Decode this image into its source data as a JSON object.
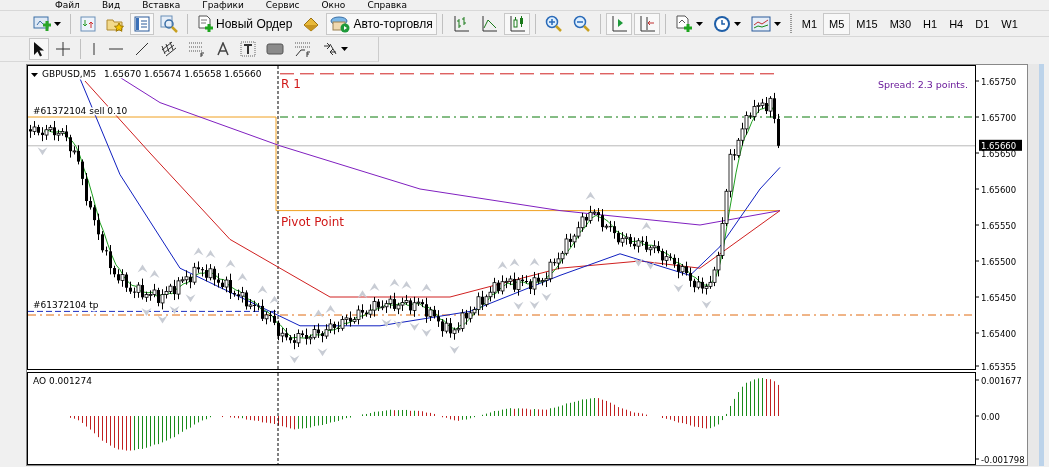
{
  "menu": [
    "Файл",
    "Вид",
    "Вставка",
    "Графики",
    "Сервис",
    "Окно",
    "Справка"
  ],
  "toolbar": {
    "new_order": "Новый Ордер",
    "autotrading": "Авто-торговля",
    "timeframes": [
      {
        "label": "M1",
        "selected": false
      },
      {
        "label": "M5",
        "selected": true
      },
      {
        "label": "M15",
        "selected": false
      },
      {
        "label": "M30",
        "selected": false
      },
      {
        "label": "H1",
        "selected": false
      },
      {
        "label": "H4",
        "selected": false
      },
      {
        "label": "D1",
        "selected": false
      },
      {
        "label": "W1",
        "selected": false
      }
    ]
  },
  "drawing_tools": [
    {
      "selected": true
    },
    {
      "selected": false
    },
    {
      "selected": false
    },
    {
      "selected": false
    },
    {
      "selected": false
    },
    {
      "selected": false
    },
    {
      "selected": false
    },
    {
      "selected": false
    },
    {
      "selected": false
    },
    {
      "selected": false
    },
    {
      "selected": false
    }
  ],
  "chart": {
    "symbol": "GBPUSD,M5",
    "ohlc": "1.65670 1.65674 1.65658 1.65660",
    "r1_label": "R 1",
    "spread": "Spread: 2.3 points.",
    "order_label": "#61372104 sell 0.10",
    "pivot_label": "Pivot Point",
    "tp_label": "#61372104 tp",
    "current_price": "1.65660",
    "price_scale": [
      "1.65750",
      "1.65700",
      "1.65650",
      "1.65600",
      "1.65550",
      "1.65500",
      "1.65450",
      "1.65400",
      "1.65355"
    ]
  },
  "indicator": {
    "title": "AO 0.001274",
    "scale": [
      "0.001677",
      "0.00",
      "-0.001798"
    ]
  }
}
